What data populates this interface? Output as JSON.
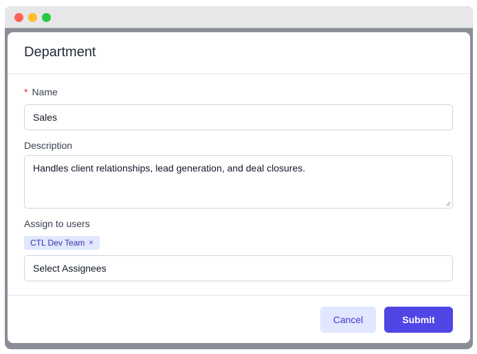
{
  "modal": {
    "title": "Department",
    "name_label": "Name",
    "required_mark": "*",
    "name_value": "Sales",
    "description_label": "Description",
    "description_value": "Handles client relationships, lead generation, and deal closures.",
    "assign_label": "Assign to users",
    "assigned_tags": [
      "CTL Dev Team"
    ],
    "tag_remove_glyph": "×",
    "assignee_placeholder": "Select Assignees",
    "cancel_label": "Cancel",
    "submit_label": "Submit"
  },
  "colors": {
    "accent": "#4f46e5",
    "accent_light": "#e0e7ff",
    "required": "#dc2626"
  }
}
